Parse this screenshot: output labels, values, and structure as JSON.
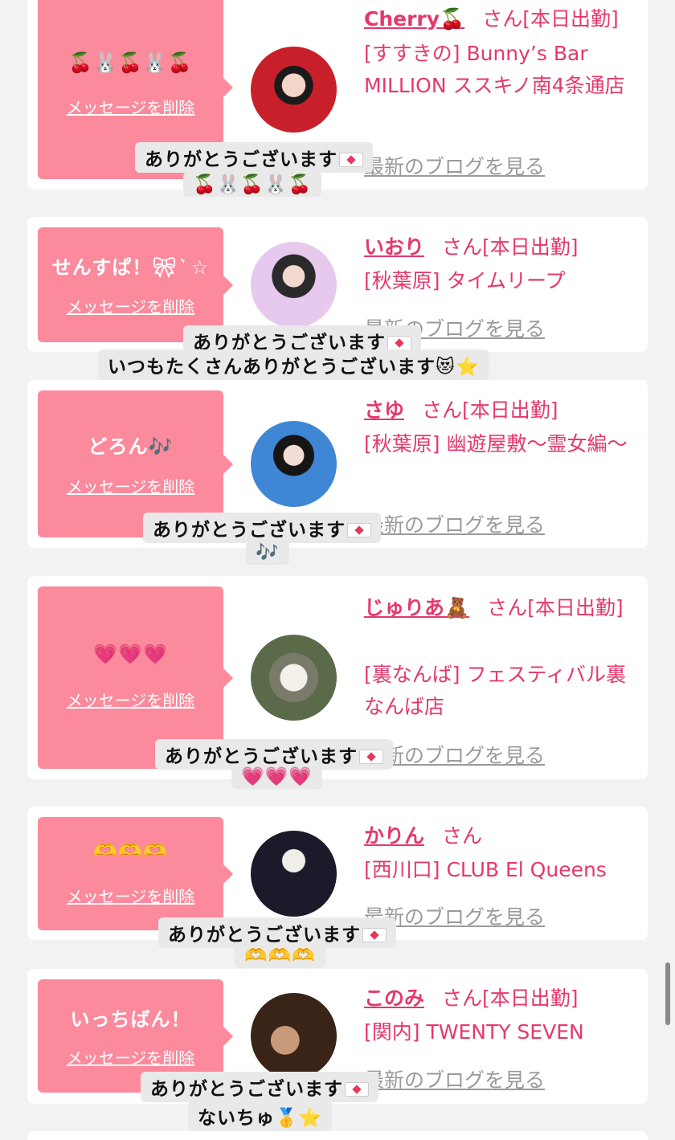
{
  "common": {
    "san": "さん",
    "delete_label": "メッセージを削除",
    "blog_label": "最新のブログを見る",
    "reply_label": "ありがとうございます"
  },
  "colors": {
    "accent": "#e5386b",
    "bubble": "#fb8a9c",
    "background": "#f2f2f2"
  },
  "entries": [
    {
      "message": "🍒🐰🍒🐰🍒",
      "name": "Cherry🍒",
      "status": "[本日出勤]",
      "shop": "[すすきの] Bunny’s Bar MILLION ススキノ南4条通店",
      "reply_line2": "🍒🐰🍒🐰🍒"
    },
    {
      "message": "せんすぱ！🎀︎︎ ͛ ☆",
      "name": "いおり",
      "status": "[本日出勤]",
      "shop": "[秋葉原] タイムリープ",
      "reply_line2": "いつもたくさんありがとうございます😻⭐️"
    },
    {
      "message": "どろん🎶",
      "name": "さゆ",
      "status": "[本日出勤]",
      "shop": "[秋葉原] 幽遊屋敷～霊女編～",
      "reply_line2": "🎶"
    },
    {
      "message": "💗💗💗",
      "name": "じゅりあ🧸",
      "status": "[本日出勤]",
      "shop": "[裏なんば] フェスティバル裏なんば店",
      "reply_line2": "💗💗💗"
    },
    {
      "message": "🫶🫶🫶",
      "name": "かりん",
      "status": "",
      "shop": "[西川口] CLUB El Queens",
      "reply_line2": "🫶🫶🫶"
    },
    {
      "message": "いっちばん！",
      "name": "このみ",
      "status": "[本日出勤]",
      "shop": "[関内] TWENTY SEVEN",
      "reply_line2": "ないちゅ🥇⭐️"
    }
  ]
}
